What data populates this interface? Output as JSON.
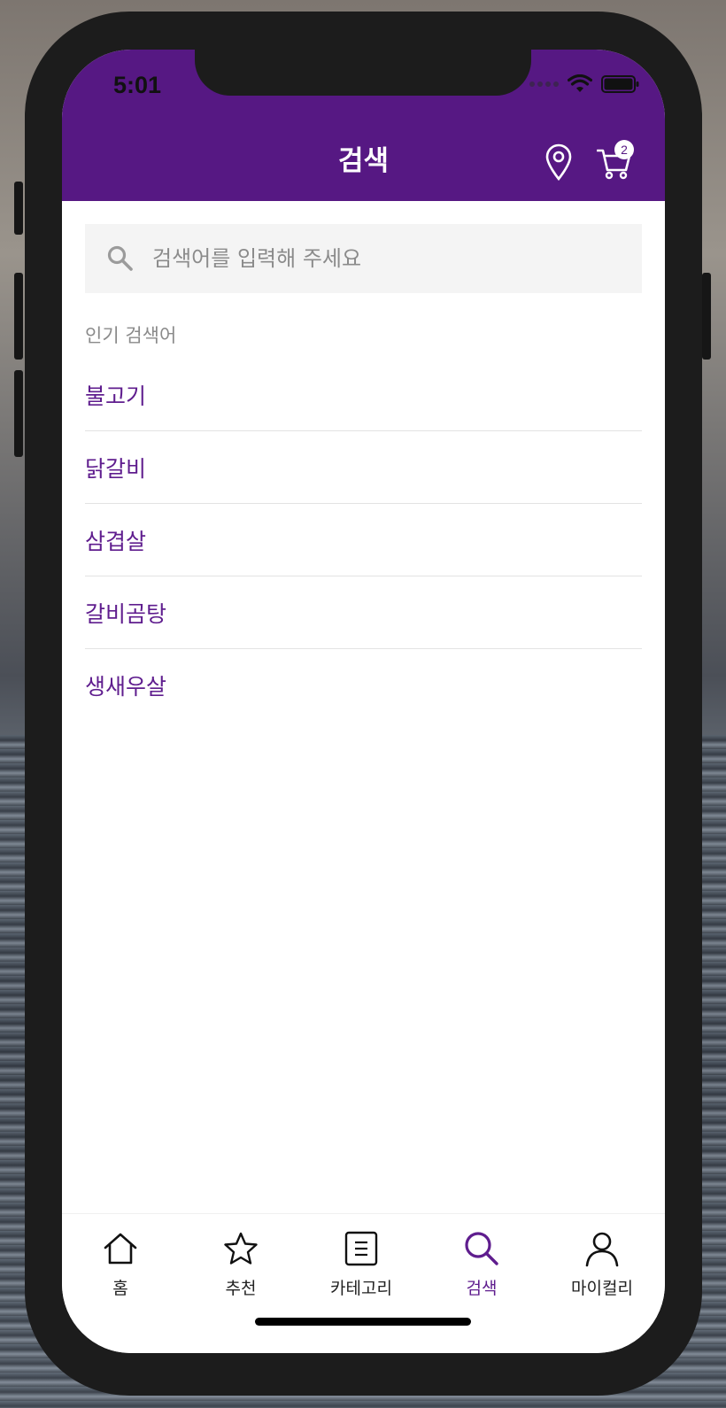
{
  "status": {
    "time": "5:01"
  },
  "header": {
    "title": "검색",
    "cart_count": "2"
  },
  "search": {
    "placeholder": "검색어를 입력해 주세요"
  },
  "popular": {
    "title": "인기 검색어",
    "keywords": [
      "불고기",
      "닭갈비",
      "삼겹살",
      "갈비곰탕",
      "생새우살"
    ]
  },
  "tabbar": {
    "items": [
      {
        "label": "홈",
        "icon": "home-icon"
      },
      {
        "label": "추천",
        "icon": "star-icon"
      },
      {
        "label": "카테고리",
        "icon": "list-icon"
      },
      {
        "label": "검색",
        "icon": "search-icon",
        "active": true
      },
      {
        "label": "마이컬리",
        "icon": "user-icon"
      }
    ]
  },
  "colors": {
    "brand": "#561883",
    "accent_text": "#5f1d8e"
  }
}
